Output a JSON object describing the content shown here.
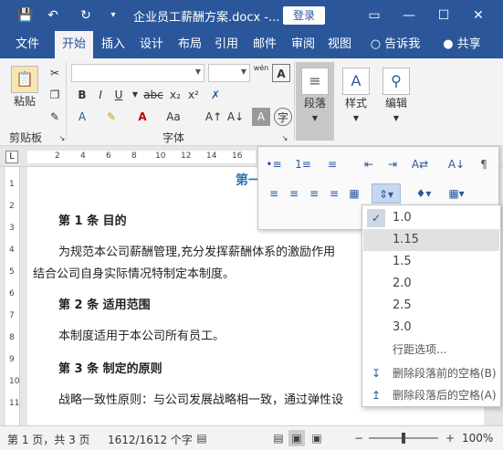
{
  "titlebar": {
    "title": "企业员工薪酬方案.docx -...",
    "login": "登录",
    "save_glyph": "💾",
    "undo_glyph": "↶",
    "redo_glyph": "↻",
    "qat_more_glyph": "▾",
    "ribbon_opts_glyph": "▭",
    "min_glyph": "—",
    "max_glyph": "☐",
    "close_glyph": "✕"
  },
  "tabs": [
    {
      "label": "文件"
    },
    {
      "label": "开始"
    },
    {
      "label": "插入"
    },
    {
      "label": "设计"
    },
    {
      "label": "布局"
    },
    {
      "label": "引用"
    },
    {
      "label": "邮件"
    },
    {
      "label": "审阅"
    },
    {
      "label": "视图"
    },
    {
      "label": "告诉我"
    },
    {
      "label": "共享"
    }
  ],
  "ribbon": {
    "paste": "粘贴",
    "clipboard": "剪贴板",
    "font": "字体",
    "paragraph": "段落",
    "styles": "样式",
    "editing": "编辑",
    "font_name": "",
    "font_size": "",
    "wen": "wén",
    "A_glyph": "A"
  },
  "ruler": {
    "corner": "L",
    "h_numbers": [
      "2",
      "4",
      "6",
      "8",
      "10",
      "12",
      "14",
      "16"
    ],
    "v_numbers": [
      "1",
      "2",
      "3",
      "4",
      "5",
      "6",
      "7",
      "8",
      "9",
      "10",
      "11"
    ]
  },
  "document": {
    "title_fragment": "第一",
    "lines": [
      {
        "text": "第 1 条   目的",
        "heading": true
      },
      {
        "text": "为规范本公司薪酬管理,充分发挥薪酬体系的激励作用",
        "heading": false
      },
      {
        "text": "结合公司自身实际情况特制定本制度。",
        "heading": false
      },
      {
        "text": "第 2 条   适用范围",
        "heading": true
      },
      {
        "text": "本制度适用于本公司所有员工。",
        "heading": false
      },
      {
        "text": "第 3 条   制定的原则",
        "heading": true
      },
      {
        "text": "战略一致性原则：与公司发展战略相一致，通过弹性设",
        "heading": false
      }
    ]
  },
  "line_spacing": {
    "options": [
      "1.0",
      "1.15",
      "1.5",
      "2.0",
      "2.5",
      "3.0"
    ],
    "selected": "1.0",
    "hovered": "1.15",
    "options_link": "行距选项...",
    "remove_before": "删除段落前的空格(B)",
    "remove_after": "删除段落后的空格(A)"
  },
  "statusbar": {
    "page": "第 1 页，共 3 页",
    "words": "1612/1612 个字",
    "zoom": "100%",
    "zoom_fraction": 0.5,
    "minus": "−",
    "plus": "+"
  },
  "colors": {
    "accent": "#2b579a",
    "title_blue": "#2e74b5"
  }
}
